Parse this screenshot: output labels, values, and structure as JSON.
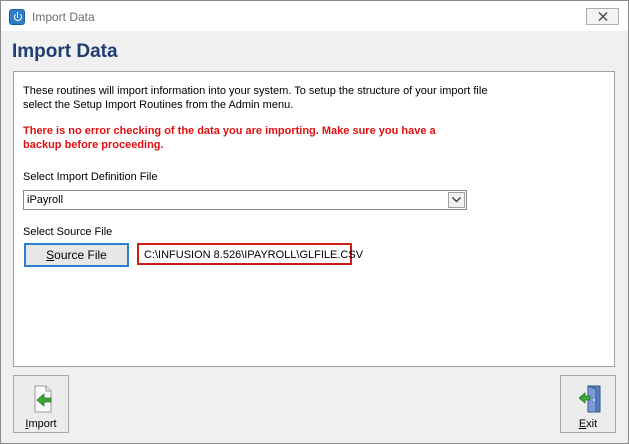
{
  "window": {
    "title": "Import Data"
  },
  "heading": "Import Data",
  "panel": {
    "info_line1": "These routines will import information into your system.  To setup the structure of your import file",
    "info_line2": "select the Setup Import Routines from the Admin menu.",
    "warning_line1": "There is no error checking of the data you are importing.  Make sure you have a",
    "warning_line2": "backup before proceeding.",
    "definition_label": "Select Import Definition File",
    "definition_value": "iPayroll",
    "source_label": "Select Source File",
    "source_button": {
      "first": "S",
      "rest": "ource File"
    },
    "source_path": "C:\\INFUSION 8.526\\IPAYROLL\\GLFILE.CSV"
  },
  "footer": {
    "import": {
      "first": "I",
      "rest": "mport",
      "icon": "import-arrow-icon"
    },
    "exit": {
      "first": "E",
      "rest": "xit",
      "icon": "exit-door-icon"
    }
  },
  "colors": {
    "heading": "#1f3d73",
    "warning": "#e01010",
    "focus_border": "#2b7fd2",
    "highlight_border": "#d11a1a"
  }
}
